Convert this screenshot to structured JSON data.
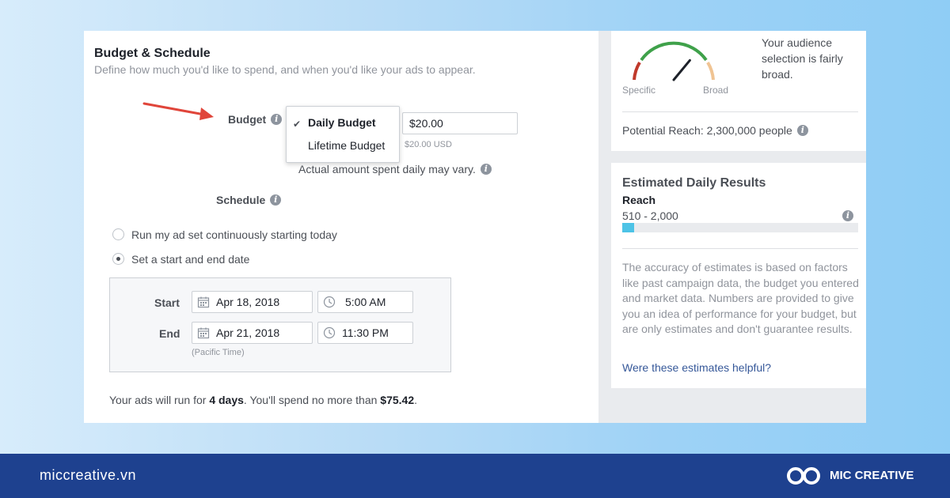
{
  "section": {
    "title": "Budget & Schedule",
    "subtitle": "Define how much you'd like to spend, and when you'd like your ads to appear."
  },
  "budget": {
    "label": "Budget",
    "options": [
      "Daily Budget",
      "Lifetime Budget"
    ],
    "selected": "Daily Budget",
    "amount": "$20.00",
    "amount_hint": "$20.00 USD",
    "note": "Actual amount spent daily may vary."
  },
  "schedule": {
    "label": "Schedule",
    "option_continuous": "Run my ad set continuously starting today",
    "option_start_end": "Set a start and end date",
    "selected": "Set a start and end date",
    "start_label": "Start",
    "end_label": "End",
    "start_date": "Apr 18, 2018",
    "start_time": "5:00 AM",
    "end_date": "Apr 21, 2018",
    "end_time": "11:30 PM",
    "timezone": "(Pacific Time)"
  },
  "summary": {
    "prefix": "Your ads will run for ",
    "days": "4 days",
    "middle": ". You'll spend no more than ",
    "amount": "$75.42",
    "suffix": "."
  },
  "audience": {
    "description": "Your audience selection is fairly broad.",
    "gauge_left": "Specific",
    "gauge_right": "Broad",
    "gauge_level": 0.72,
    "potential_reach": "Potential Reach: 2,300,000 people"
  },
  "estimates": {
    "title": "Estimated Daily Results",
    "metric": "Reach",
    "range": "510 - 2,000",
    "bar_fill": 0.05,
    "bar_color": "#4dc3e6",
    "disclaimer": "The accuracy of estimates is based on factors like past campaign data, the budget you entered and market data. Numbers are provided to give you an idea of performance for your budget, but are only estimates and don't guarantee results.",
    "feedback_link": "Were these estimates helpful?"
  },
  "footer": {
    "url": "miccreative.vn",
    "brand": "MIC CREATIVE"
  },
  "colors": {
    "footer_bg": "#1e418f",
    "link": "#365899",
    "arrow": "#e0453a"
  }
}
